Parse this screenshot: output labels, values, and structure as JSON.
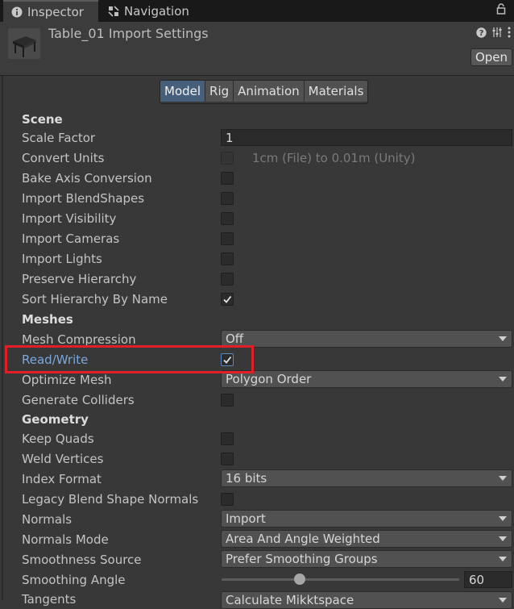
{
  "tabs": [
    {
      "label": "Inspector",
      "icon": "info-icon",
      "active": true
    },
    {
      "label": "Navigation",
      "icon": "navigation-icon",
      "active": false
    }
  ],
  "header": {
    "title": "Table_01 Import Settings",
    "open_label": "Open"
  },
  "segments": [
    "Model",
    "Rig",
    "Animation",
    "Materials"
  ],
  "scene": {
    "heading": "Scene",
    "scale_factor_label": "Scale Factor",
    "scale_factor_value": "1",
    "convert_units_label": "Convert Units",
    "convert_units_note": "1cm (File) to 0.01m (Unity)",
    "bake_axis_label": "Bake Axis Conversion",
    "blendshapes_label": "Import BlendShapes",
    "visibility_label": "Import Visibility",
    "cameras_label": "Import Cameras",
    "lights_label": "Import Lights",
    "hierarchy_label": "Preserve Hierarchy",
    "sort_label": "Sort Hierarchy By Name"
  },
  "meshes": {
    "heading": "Meshes",
    "compression_label": "Mesh Compression",
    "compression_value": "Off",
    "readwrite_label": "Read/Write",
    "optimize_label": "Optimize Mesh",
    "optimize_value": "Polygon Order",
    "colliders_label": "Generate Colliders"
  },
  "geometry": {
    "heading": "Geometry",
    "quads_label": "Keep Quads",
    "weld_label": "Weld Vertices",
    "index_label": "Index Format",
    "index_value": "16 bits",
    "legacy_label": "Legacy Blend Shape Normals",
    "normals_label": "Normals",
    "normals_value": "Import",
    "normals_mode_label": "Normals Mode",
    "normals_mode_value": "Area And Angle Weighted",
    "smooth_source_label": "Smoothness Source",
    "smooth_source_value": "Prefer Smoothing Groups",
    "smooth_angle_label": "Smoothing Angle",
    "smooth_angle_value": "60",
    "smooth_angle_fraction": 0.33,
    "tangents_label": "Tangents",
    "tangents_value": "Calculate Mikktspace"
  },
  "checkboxes": {
    "convert_units": false,
    "bake_axis": false,
    "blendshapes": false,
    "visibility": false,
    "cameras": false,
    "lights": false,
    "hierarchy": false,
    "sort": true,
    "readwrite": true,
    "colliders": false,
    "quads": false,
    "weld": false,
    "legacy": false
  },
  "colors": {
    "background": "#383838",
    "accent_selected": "#46607c",
    "highlight_box": "#e21f26",
    "highlight_label": "#7ca8dc"
  }
}
